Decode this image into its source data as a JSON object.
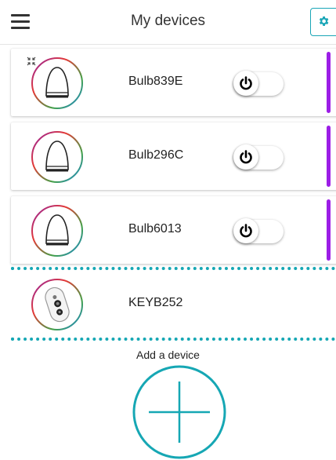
{
  "header": {
    "title": "My devices",
    "menu_icon": "hamburger-menu-icon",
    "settings_icon": "gear-icon"
  },
  "colors": {
    "accent": "#16a7b4",
    "level_bar": "#9c1ee6",
    "ring_gradient": [
      "#e53935",
      "#43a047",
      "#1e88e5",
      "#8e24aa"
    ]
  },
  "devices": [
    {
      "name": "Bulb839E",
      "type": "bulb",
      "icon": "bulb-icon",
      "power": "off",
      "level_indicator": 1.0,
      "badge_icon": "collapse-icon"
    },
    {
      "name": "Bulb296C",
      "type": "bulb",
      "icon": "bulb-icon",
      "power": "off",
      "level_indicator": 1.0
    },
    {
      "name": "Bulb6013",
      "type": "bulb",
      "icon": "bulb-icon",
      "power": "off",
      "level_indicator": 1.0
    },
    {
      "name": "KEYB252",
      "type": "remote",
      "icon": "remote-keyfob-icon",
      "selected": true
    }
  ],
  "add_device": {
    "label": "Add a device",
    "icon": "plus-circle-icon"
  }
}
